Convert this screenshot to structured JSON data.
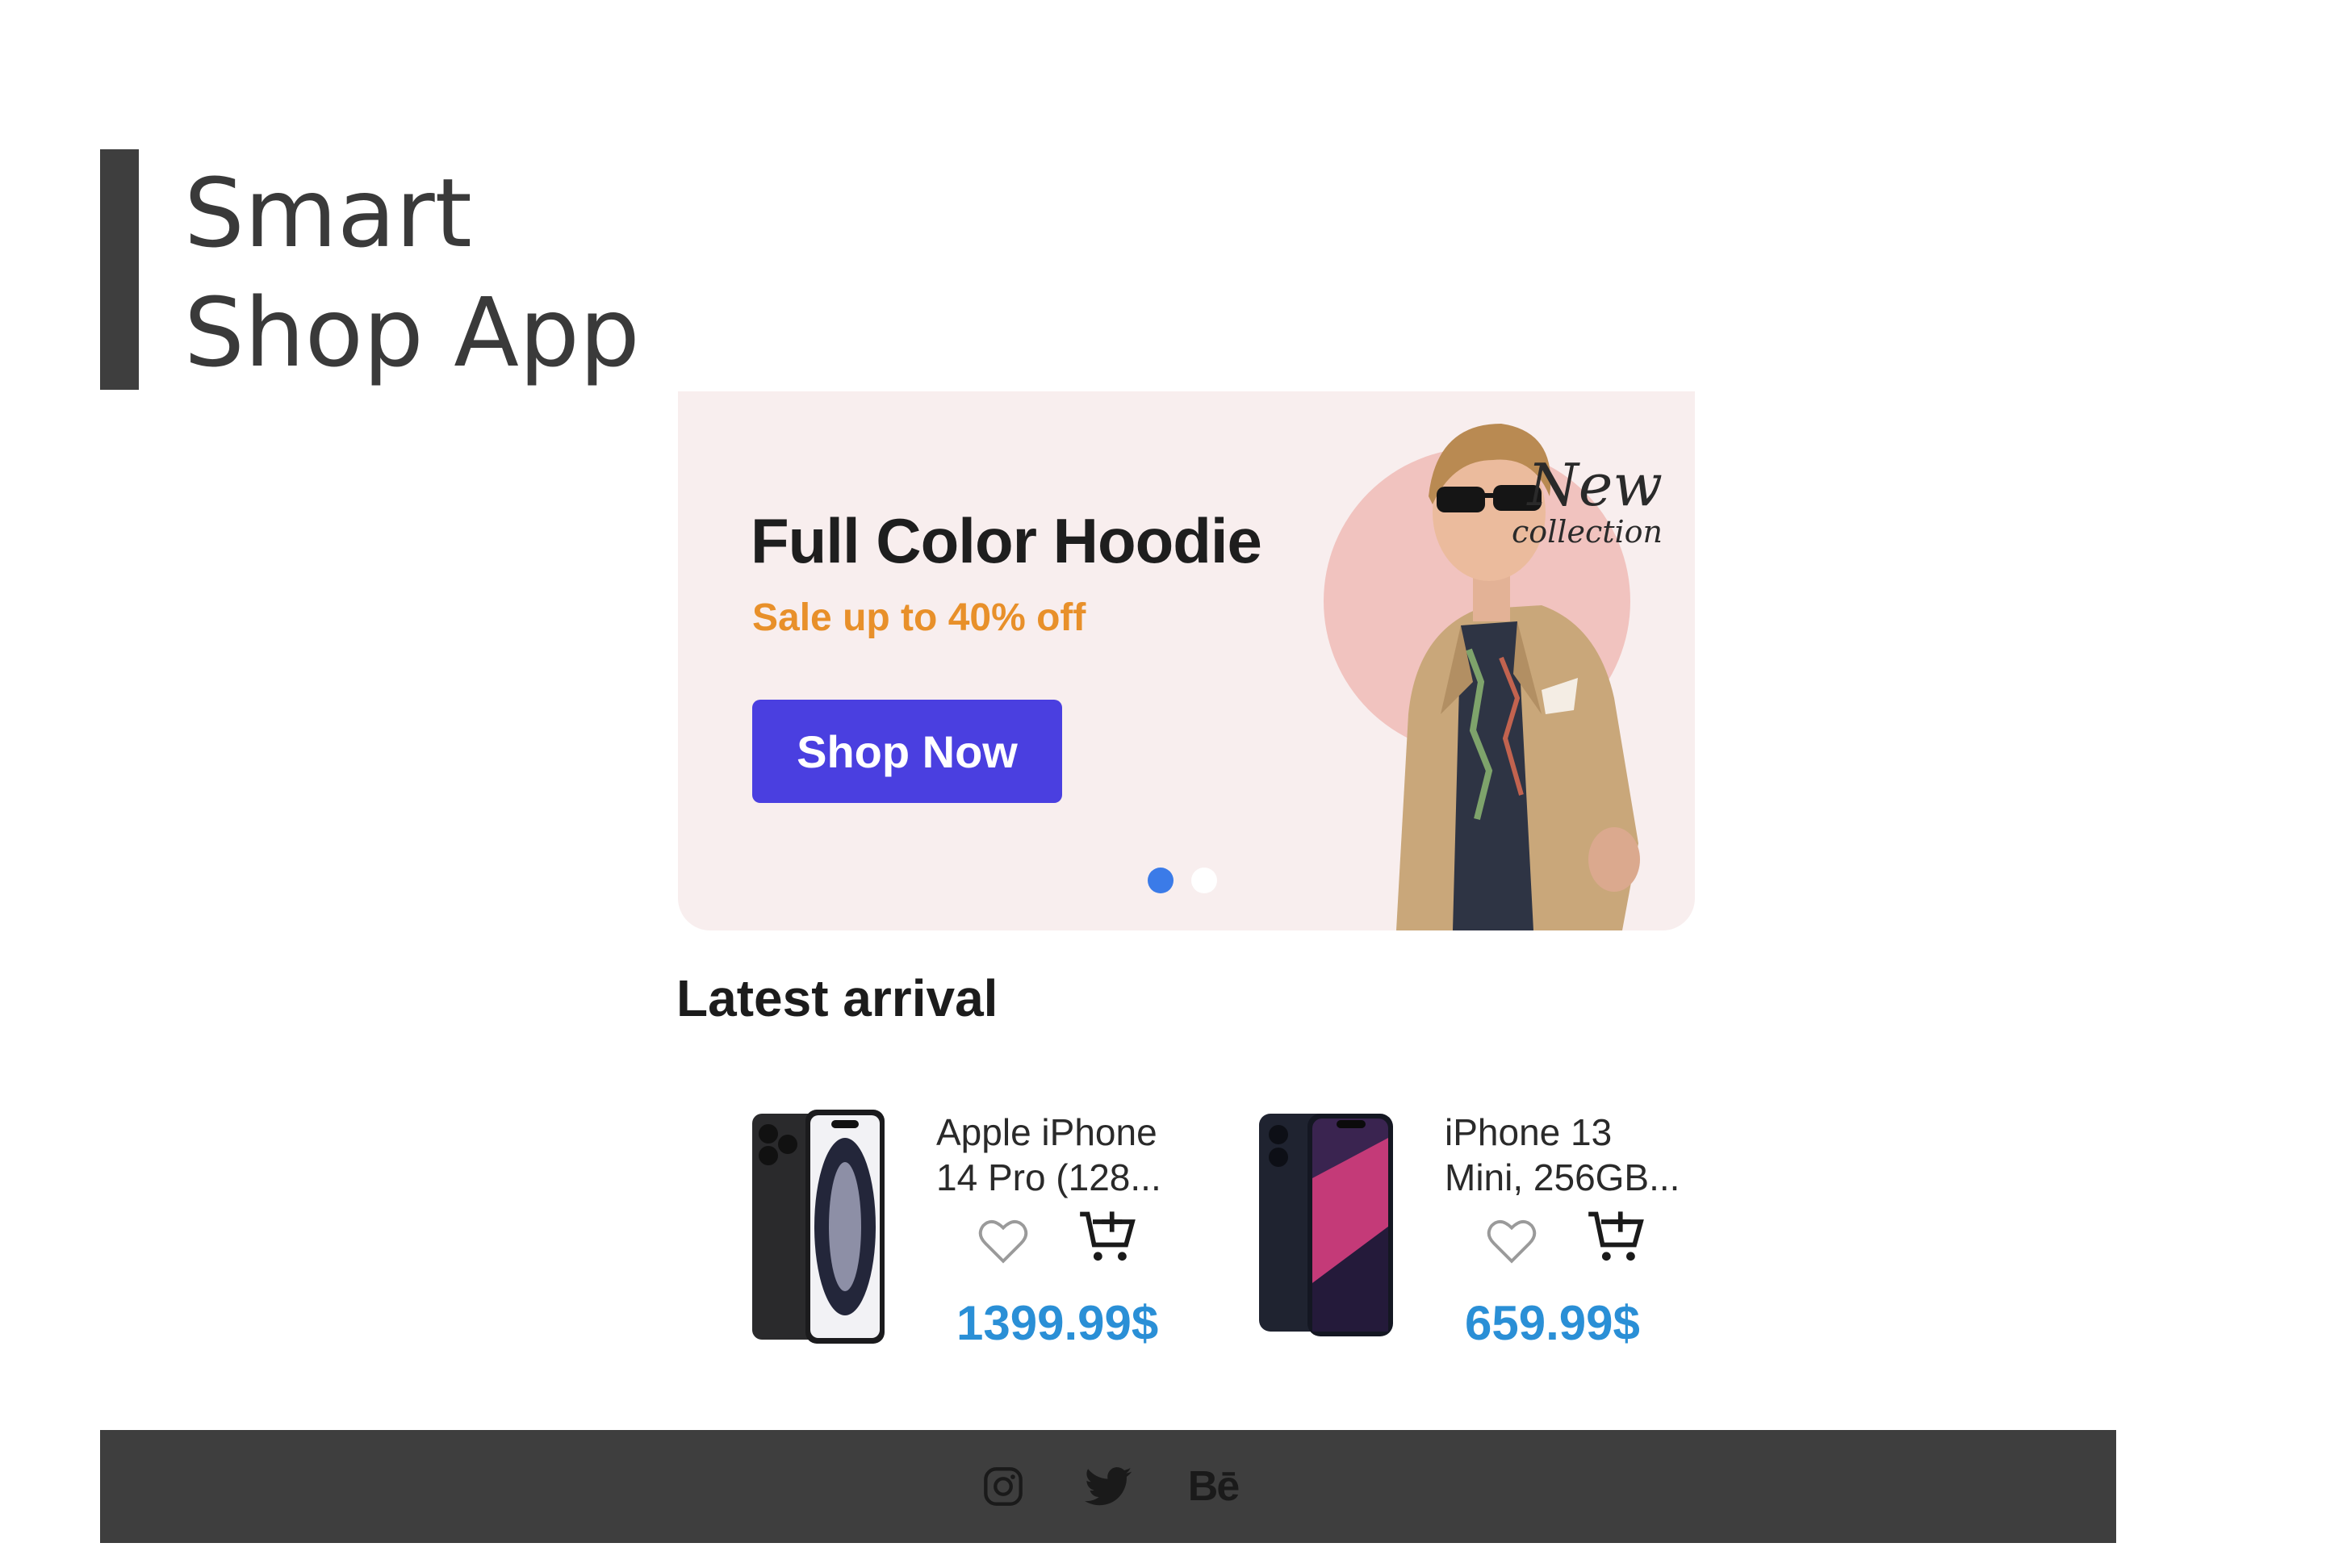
{
  "header": {
    "title_line1": "Smart",
    "title_line2": "Shop App"
  },
  "banner": {
    "headline": "Full Color Hoodie",
    "subline": "Sale up to 40% off",
    "button_label": "Shop Now",
    "script_line1": "New",
    "script_line2": "collection",
    "slides_total": 2,
    "active_slide": 1
  },
  "latest": {
    "title": "Latest arrival",
    "products": [
      {
        "name_line1": "Apple iPhone",
        "name_line2": "14 Pro (128...",
        "price": "1399.99$",
        "image": "iphone-14-pro-image"
      },
      {
        "name_line1": "iPhone 13",
        "name_line2": "Mini, 256GB...",
        "price": "659.99$",
        "image": "iphone-13-mini-image"
      }
    ]
  },
  "footer": {
    "icons": [
      "instagram-icon",
      "twitter-icon",
      "behance-icon"
    ],
    "behance_label": "Bē"
  },
  "colors": {
    "accent": "#4a3fe0",
    "sale": "#e8902a",
    "price": "#2a8fd6",
    "dark": "#3e3e3e",
    "banner_bg": "#f8eeee"
  }
}
